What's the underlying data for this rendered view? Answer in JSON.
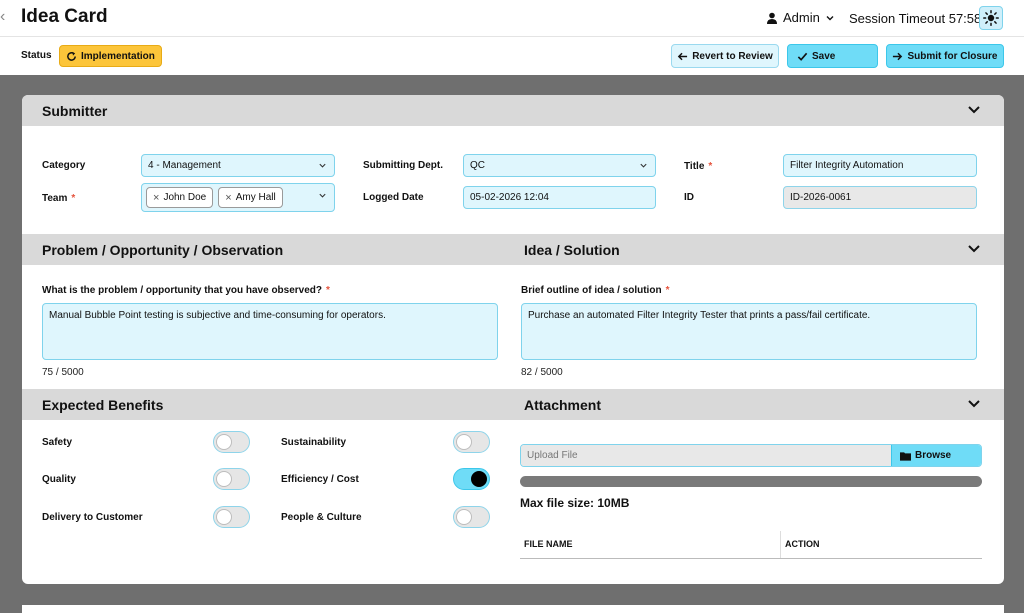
{
  "header": {
    "back": "‹",
    "title": "Idea Card",
    "user": "Admin",
    "session": "Session Timeout 57:58"
  },
  "actionbar": {
    "status_label": "Status",
    "status_value": "Implementation",
    "revert": "Revert to Review",
    "save": "Save",
    "submit": "Submit for Closure"
  },
  "submitter": {
    "title": "Submitter",
    "category_label": "Category",
    "category_value": "4 - Management",
    "team_label": "Team",
    "team_members": [
      "John Doe",
      "Amy Hall"
    ],
    "dept_label": "Submitting Dept.",
    "dept_value": "QC",
    "logged_label": "Logged Date",
    "logged_value": "05-02-2026 12:04",
    "title_label": "Title",
    "title_value": "Filter Integrity Automation",
    "id_label": "ID",
    "id_value": "ID-2026-0061"
  },
  "problem": {
    "title": "Problem / Opportunity / Observation",
    "question": "What is the problem / opportunity that you have observed?",
    "text": "Manual Bubble Point testing is subjective and time-consuming for operators.",
    "counter": "75 / 5000"
  },
  "idea": {
    "title": "Idea / Solution",
    "question": "Brief outline of idea / solution",
    "text": "Purchase an automated Filter Integrity Tester that prints a pass/fail certificate.",
    "counter": "82 / 5000"
  },
  "benefits": {
    "title": "Expected Benefits",
    "items": [
      {
        "label": "Safety",
        "on": false
      },
      {
        "label": "Sustainability",
        "on": false
      },
      {
        "label": "Quality",
        "on": false
      },
      {
        "label": "Efficiency / Cost",
        "on": true
      },
      {
        "label": "Delivery to Customer",
        "on": false
      },
      {
        "label": "People & Culture",
        "on": false
      }
    ]
  },
  "attachment": {
    "title": "Attachment",
    "placeholder": "Upload File",
    "browse": "Browse",
    "progress": 1.0,
    "max_size": "Max file size: 10MB",
    "col_file": "FILE NAME",
    "col_action": "ACTION"
  },
  "colors": {
    "accent": "#6fdcf7",
    "field_bg": "#dff6fd",
    "status": "#fcc53a",
    "required": "#e5533d"
  }
}
